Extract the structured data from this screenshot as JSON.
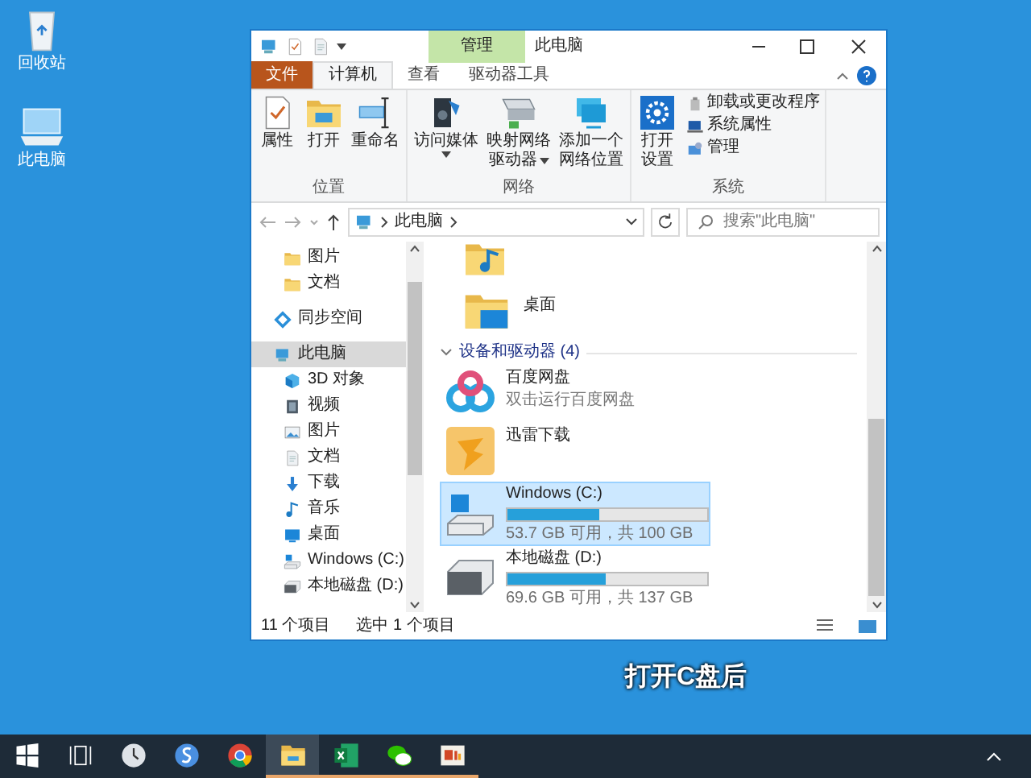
{
  "desktop_icons": [
    {
      "label": "回收站"
    },
    {
      "label": "此电脑"
    }
  ],
  "window": {
    "title": "此电脑",
    "context_tab": "管理",
    "file_tab": "文件",
    "ribbon_tabs": [
      {
        "label": "计算机",
        "selected": true
      },
      {
        "label": "查看",
        "selected": false
      },
      {
        "label": "驱动器工具",
        "selected": false
      }
    ],
    "ribbon_groups": [
      {
        "label": "位置",
        "buttons": [
          {
            "lines": [
              "属性"
            ],
            "dropdown": false
          },
          {
            "lines": [
              "打开"
            ],
            "dropdown": false
          },
          {
            "lines": [
              "重命名"
            ],
            "dropdown": false
          }
        ]
      },
      {
        "label": "网络",
        "buttons": [
          {
            "lines": [
              "访问媒体"
            ],
            "dropdown": true
          },
          {
            "lines": [
              "映射网络",
              "驱动器"
            ],
            "dropdown": true
          },
          {
            "lines": [
              "添加一个",
              "网络位置"
            ],
            "dropdown": false
          }
        ]
      },
      {
        "label": "系统",
        "buttons": [
          {
            "lines": [
              "打开",
              "设置"
            ],
            "dropdown": false
          }
        ],
        "small_buttons": [
          {
            "label": "卸载或更改程序"
          },
          {
            "label": "系统属性"
          },
          {
            "label": "管理"
          }
        ]
      }
    ],
    "address": {
      "path": "此电脑",
      "search_placeholder": "搜索\"此电脑\""
    },
    "quick_access_items": [
      {
        "label": "图片",
        "selected": false
      },
      {
        "label": "文档",
        "selected": false
      }
    ],
    "nav_items": [
      {
        "label": "同步空间",
        "selected": false
      },
      {
        "label": "此电脑",
        "selected": true,
        "children": [
          {
            "label": "3D 对象",
            "selected": false
          },
          {
            "label": "视频",
            "selected": false
          },
          {
            "label": "图片",
            "selected": false
          },
          {
            "label": "文档",
            "selected": false
          },
          {
            "label": "下载",
            "selected": false
          },
          {
            "label": "音乐",
            "selected": false
          },
          {
            "label": "桌面",
            "selected": false
          },
          {
            "label": "Windows (C:)",
            "selected": false
          },
          {
            "label": "本地磁盘 (D:)",
            "selected": false
          }
        ]
      }
    ],
    "folders": [
      {
        "label": "桌面"
      }
    ],
    "devices_header": "设备和驱动器 (4)",
    "devices": [
      {
        "kind": "app",
        "label": "百度网盘",
        "subtitle": "双击运行百度网盘",
        "selected": false
      },
      {
        "kind": "app",
        "label": "迅雷下载",
        "selected": false
      },
      {
        "kind": "drive",
        "label": "Windows (C:)",
        "level": 0.46,
        "info": "53.7 GB 可用，共 100 GB",
        "selected": true
      },
      {
        "kind": "drive",
        "label": "本地磁盘 (D:)",
        "level": 0.49,
        "info": "69.6 GB 可用，共 137 GB",
        "selected": false
      }
    ],
    "status": {
      "count": "11 个项目",
      "selection": "选中 1 个项目"
    }
  },
  "caption": "打开C盘后",
  "taskbar": [
    {
      "running": false,
      "selected": false
    },
    {
      "running": false,
      "selected": false
    },
    {
      "running": false,
      "selected": false
    },
    {
      "running": false,
      "selected": false
    },
    {
      "running": false,
      "selected": false
    },
    {
      "running": true,
      "selected": true
    },
    {
      "running": true,
      "selected": false
    },
    {
      "running": true,
      "selected": false
    },
    {
      "running": true,
      "selected": false
    }
  ]
}
